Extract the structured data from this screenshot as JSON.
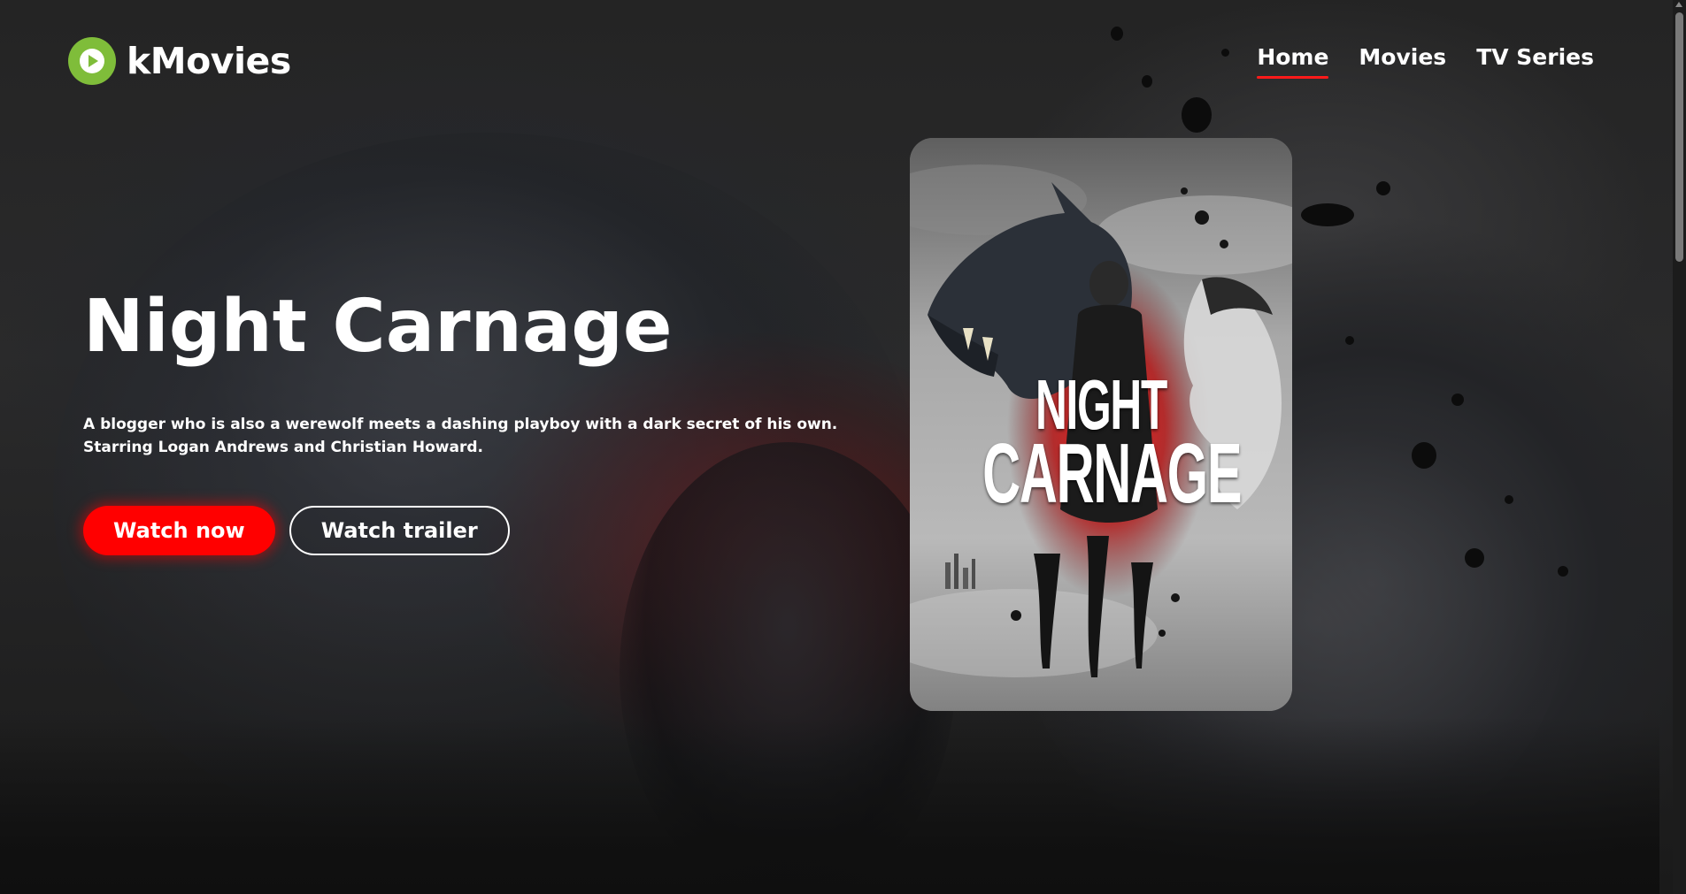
{
  "brand": {
    "name": "kMovies",
    "icon": "play-circle-icon",
    "accent_color": "#7fbd3a"
  },
  "nav": {
    "items": [
      {
        "label": "Home",
        "active": true
      },
      {
        "label": "Movies",
        "active": false
      },
      {
        "label": "TV Series",
        "active": false
      }
    ],
    "active_underline_color": "#ff1a1a"
  },
  "hero": {
    "title": "Night Carnage",
    "description": "A blogger who is also a werewolf meets a dashing playboy with a dark secret of his own. Starring Logan Andrews and Christian Howard.",
    "primary_button": "Watch now",
    "secondary_button": "Watch trailer",
    "primary_color": "#ff0000"
  },
  "poster": {
    "title_line1": "NIGHT",
    "title_line2": "CARNAGE"
  }
}
